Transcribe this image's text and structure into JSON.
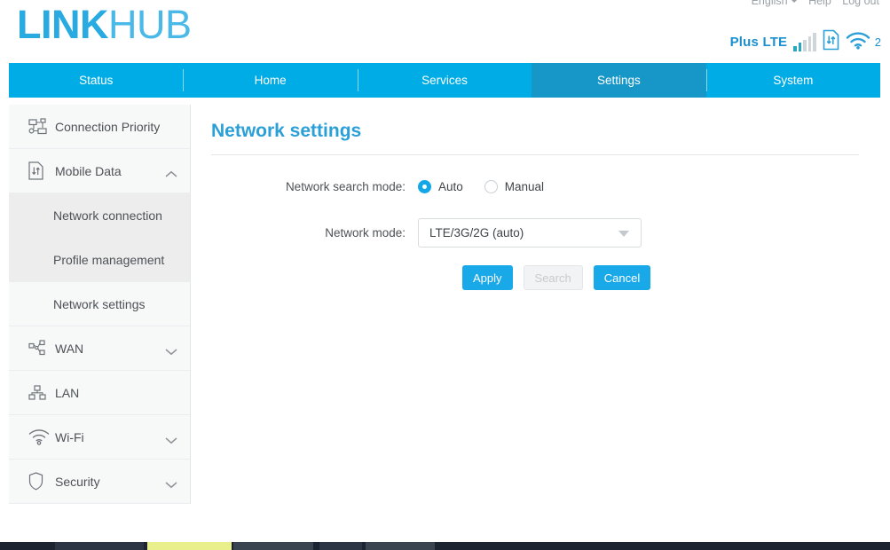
{
  "brand": {
    "part1": "LINK",
    "part2": "HUB"
  },
  "toplinks": {
    "language": "English",
    "help": "Help",
    "logout": "Log out"
  },
  "status": {
    "carrier": "Plus LTE",
    "signal_bars_total": 5,
    "signal_bars_active": 2,
    "sim_icon": "sim-card-icon",
    "wifi_icon": "wifi-icon",
    "wifi_clients": "2"
  },
  "nav": {
    "items": [
      {
        "label": "Status",
        "active": false
      },
      {
        "label": "Home",
        "active": false
      },
      {
        "label": "Services",
        "active": false
      },
      {
        "label": "Settings",
        "active": true
      },
      {
        "label": "System",
        "active": false
      }
    ]
  },
  "sidebar": {
    "items": [
      {
        "label": "Connection Priority",
        "icon": "network-nodes-icon",
        "chevron": "none"
      },
      {
        "label": "Mobile Data",
        "icon": "sim-card-icon",
        "chevron": "up"
      },
      {
        "label": "WAN",
        "icon": "wan-nodes-icon",
        "chevron": "down"
      },
      {
        "label": "LAN",
        "icon": "lan-nodes-icon",
        "chevron": "none"
      },
      {
        "label": "Wi-Fi",
        "icon": "wifi-icon",
        "chevron": "down"
      },
      {
        "label": "Security",
        "icon": "shield-icon",
        "chevron": "down"
      }
    ],
    "mobile_data_children": [
      {
        "label": "Network connection",
        "active": false
      },
      {
        "label": "Profile management",
        "active": false
      },
      {
        "label": "Network settings",
        "active": true
      }
    ]
  },
  "main": {
    "title": "Network settings",
    "search_mode": {
      "label": "Network search mode:",
      "options": [
        {
          "label": "Auto",
          "selected": true
        },
        {
          "label": "Manual",
          "selected": false
        }
      ]
    },
    "network_mode": {
      "label": "Network mode:",
      "value": "LTE/3G/2G (auto)"
    },
    "buttons": {
      "apply": "Apply",
      "search": "Search",
      "cancel": "Cancel"
    }
  },
  "colors": {
    "accent": "#00ace6",
    "accent_active_tab": "#1797c8",
    "title": "#2a9fd8",
    "button": "#19a8e8",
    "carrier_text": "#1b8fd0"
  }
}
